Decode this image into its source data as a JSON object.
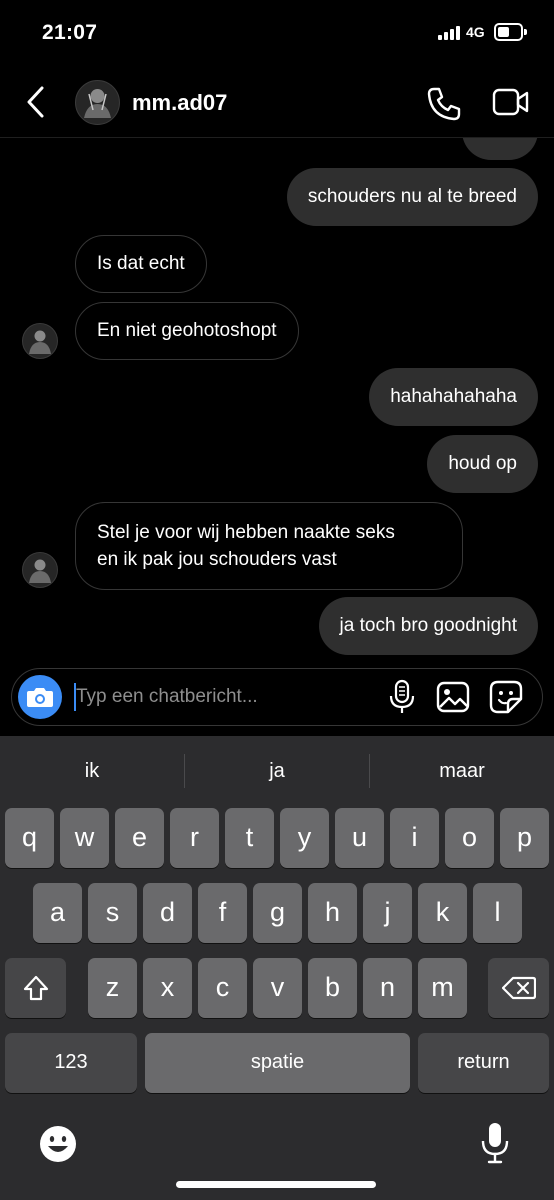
{
  "status_bar": {
    "time": "21:07",
    "network": "4G"
  },
  "header": {
    "username": "mm.ad07"
  },
  "chat": {
    "messages": [
      {
        "side": "sent",
        "text": "schouders nu al te breed"
      },
      {
        "side": "received",
        "text": "Is dat echt"
      },
      {
        "side": "received",
        "text": "En niet geohotoshopt"
      },
      {
        "side": "sent",
        "text": "hahahahahaha"
      },
      {
        "side": "sent",
        "text": "houd op"
      },
      {
        "side": "received",
        "line1": "Stel je voor wij hebben naakte seks",
        "line2": "en ik pak jou schouders vast"
      },
      {
        "side": "sent",
        "text": "ja toch bro goodnight"
      }
    ]
  },
  "composer": {
    "placeholder": "Typ een chatbericht..."
  },
  "keyboard": {
    "suggestions": [
      "ik",
      "ja",
      "maar"
    ],
    "row1": [
      "q",
      "w",
      "e",
      "r",
      "t",
      "y",
      "u",
      "i",
      "o",
      "p"
    ],
    "row2": [
      "a",
      "s",
      "d",
      "f",
      "g",
      "h",
      "j",
      "k",
      "l"
    ],
    "row3": [
      "z",
      "x",
      "c",
      "v",
      "b",
      "n",
      "m"
    ],
    "numbers_label": "123",
    "space_label": "spatie",
    "return_label": "return"
  },
  "colors": {
    "accent": "#3b8cf5",
    "sent_bubble": "#2f2f2f",
    "key": "#6a6a6c",
    "key_dark": "#464648",
    "keyboard_bg": "#2c2c2e"
  },
  "icons": [
    "back-icon",
    "phone-icon",
    "video-camera-icon",
    "camera-icon",
    "microphone-icon",
    "image-icon",
    "sticker-icon",
    "shift-icon",
    "backspace-icon",
    "emoji-icon"
  ]
}
